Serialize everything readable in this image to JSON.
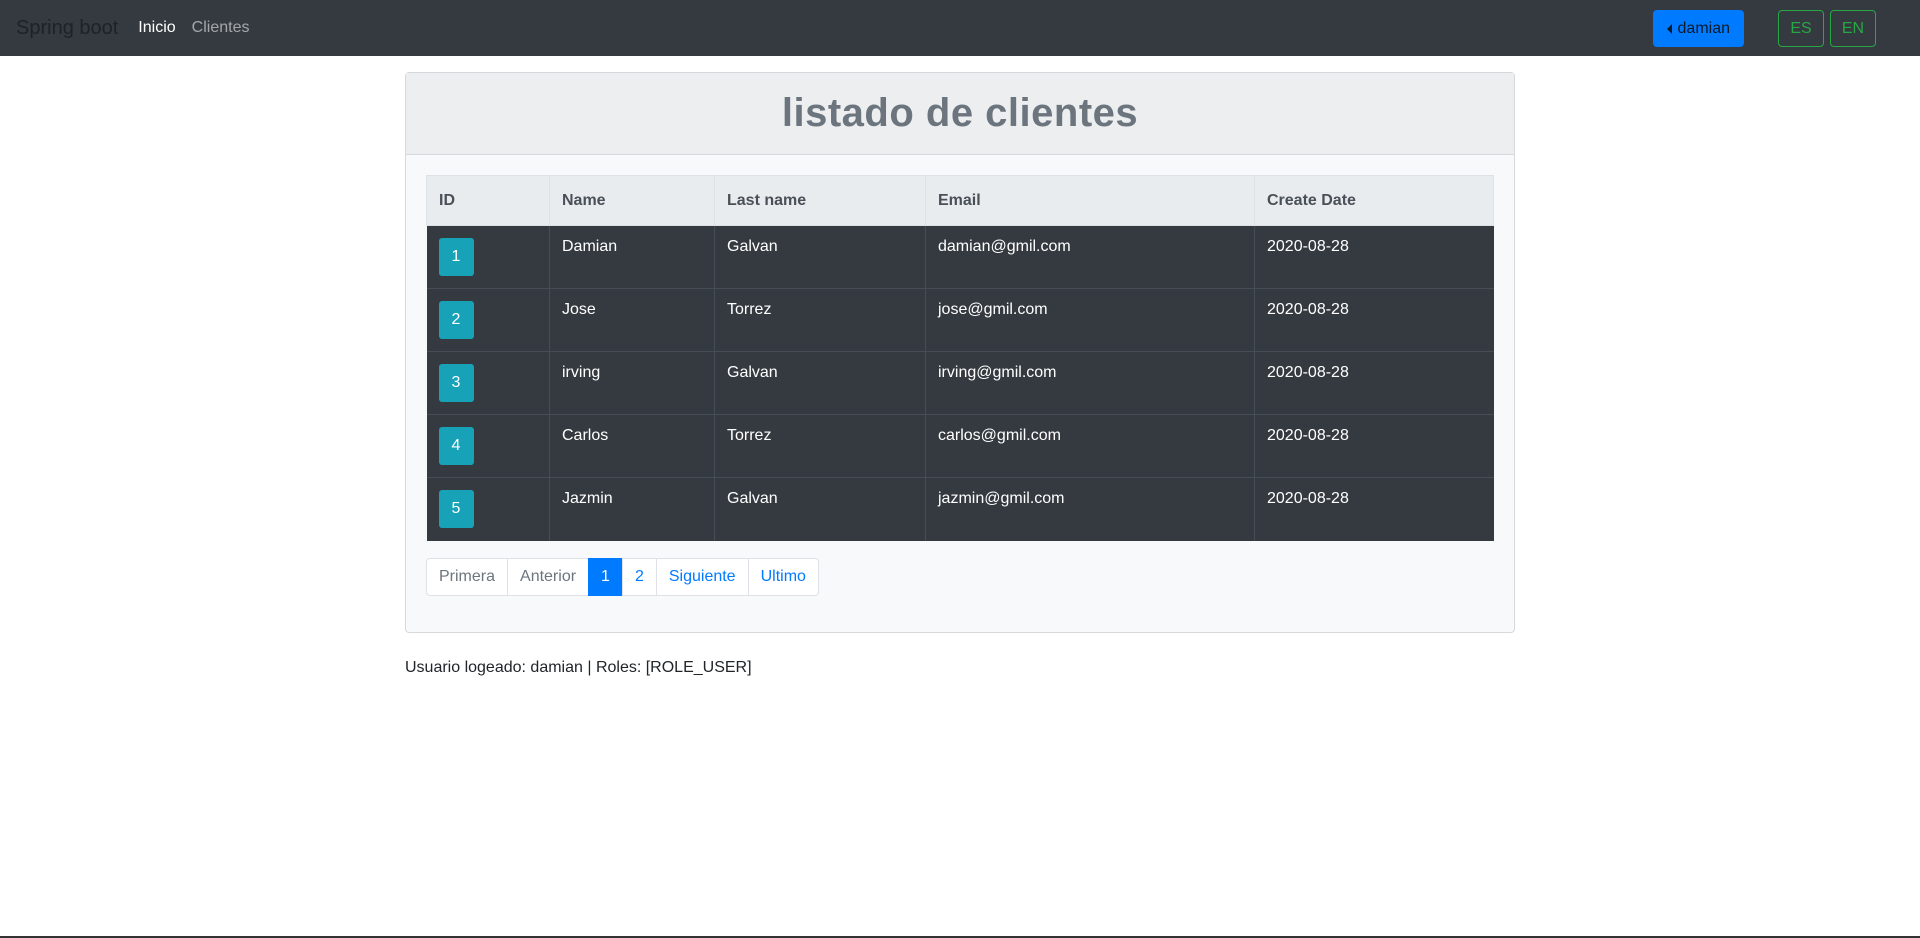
{
  "navbar": {
    "brand": "Spring boot",
    "links": [
      {
        "label": "Inicio",
        "active": true
      },
      {
        "label": "Clientes",
        "active": false
      }
    ],
    "user_button": "damian",
    "lang_buttons": [
      "ES",
      "EN"
    ]
  },
  "card": {
    "title": "listado de clientes",
    "columns": [
      "ID",
      "Name",
      "Last name",
      "Email",
      "Create Date"
    ],
    "rows": [
      {
        "id": "1",
        "name": "Damian",
        "last_name": "Galvan",
        "email": "damian@gmil.com",
        "create_date": "2020-08-28"
      },
      {
        "id": "2",
        "name": "Jose",
        "last_name": "Torrez",
        "email": "jose@gmil.com",
        "create_date": "2020-08-28"
      },
      {
        "id": "3",
        "name": "irving",
        "last_name": "Galvan",
        "email": "irving@gmil.com",
        "create_date": "2020-08-28"
      },
      {
        "id": "4",
        "name": "Carlos",
        "last_name": "Torrez",
        "email": "carlos@gmil.com",
        "create_date": "2020-08-28"
      },
      {
        "id": "5",
        "name": "Jazmin",
        "last_name": "Galvan",
        "email": "jazmin@gmil.com",
        "create_date": "2020-08-28"
      }
    ],
    "pagination": {
      "first": "Primera",
      "previous": "Anterior",
      "pages": [
        "1",
        "2"
      ],
      "current_page": "1",
      "next": "Siguiente",
      "last": "Ultimo"
    }
  },
  "footer": {
    "logged_user": "Usuario logeado: damian | Roles: [ROLE_USER]"
  },
  "colors": {
    "navbar_bg": "#343a40",
    "primary": "#007bff",
    "success": "#28a745",
    "info": "#17a2b8",
    "table_dark": "#343a40"
  }
}
